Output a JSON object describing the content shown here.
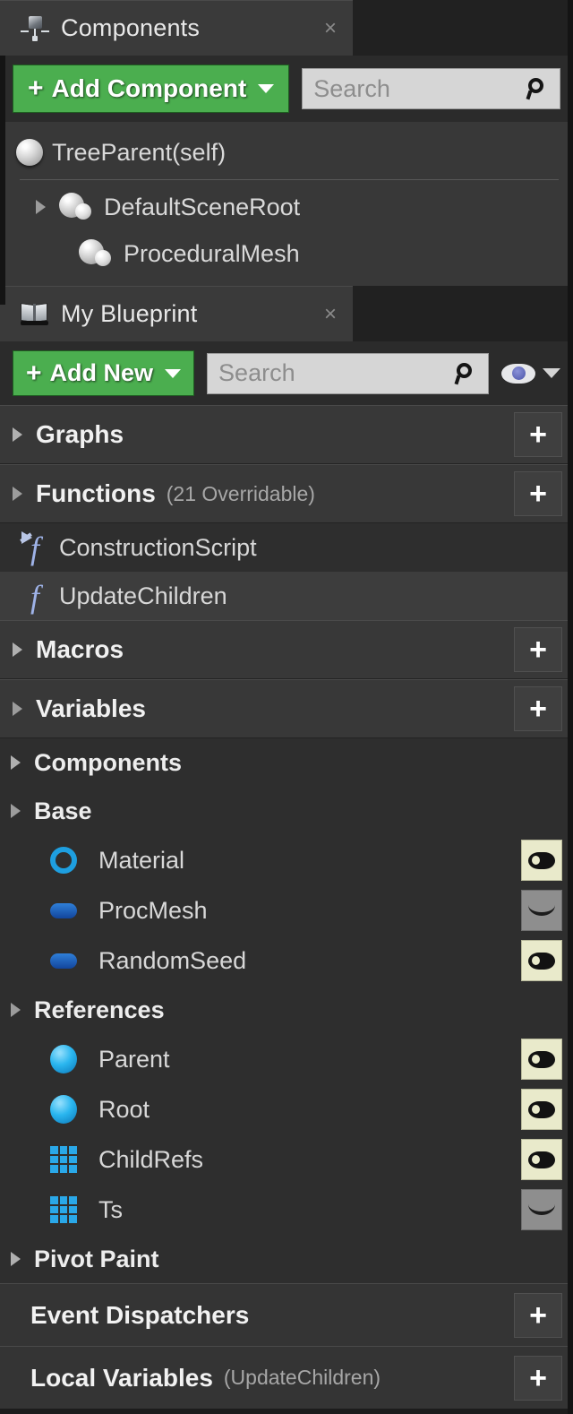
{
  "components_panel": {
    "tab": {
      "title": "Components",
      "icon": "components-cube-icon",
      "close": "×"
    },
    "toolbar": {
      "add_label": "Add Component",
      "plus": "+",
      "search_placeholder": "Search"
    },
    "tree": [
      {
        "label": "TreeParent(self)",
        "icon": "sphere-icon",
        "indent": 0,
        "arrow": "none"
      },
      {
        "label": "DefaultSceneRoot",
        "icon": "scene-component-icon",
        "indent": 1,
        "arrow": "expanded"
      },
      {
        "label": "ProceduralMesh",
        "icon": "scene-component-icon",
        "indent": 2,
        "arrow": "none"
      }
    ]
  },
  "my_blueprint_panel": {
    "tab": {
      "title": "My Blueprint",
      "icon": "book-icon",
      "close": "×"
    },
    "toolbar": {
      "add_label": "Add New",
      "plus": "+",
      "search_placeholder": "Search",
      "eye_icon": "eye-visibility-icon"
    },
    "sections": {
      "graphs": {
        "label": "Graphs",
        "expanded": false,
        "add": "+"
      },
      "functions": {
        "label": "Functions",
        "sub": "(21 Overridable)",
        "expanded": true,
        "add": "+",
        "items": [
          {
            "label": "ConstructionScript",
            "icon": "construction-script-icon",
            "selected": false
          },
          {
            "label": "UpdateChildren",
            "icon": "function-icon",
            "selected": true
          }
        ]
      },
      "macros": {
        "label": "Macros",
        "expanded": false,
        "add": "+"
      },
      "variables": {
        "label": "Variables",
        "expanded": true,
        "add": "+",
        "categories": [
          {
            "label": "Components",
            "expanded": false,
            "vars": []
          },
          {
            "label": "Base",
            "expanded": true,
            "vars": [
              {
                "label": "Material",
                "type_icon": "object-ring-icon",
                "eye": "visible"
              },
              {
                "label": "ProcMesh",
                "type_icon": "pill-icon",
                "eye": "hidden"
              },
              {
                "label": "RandomSeed",
                "type_icon": "pill-icon",
                "eye": "visible"
              }
            ]
          },
          {
            "label": "References",
            "expanded": true,
            "vars": [
              {
                "label": "Parent",
                "type_icon": "object-ball-icon",
                "eye": "visible"
              },
              {
                "label": "Root",
                "type_icon": "object-ball-icon",
                "eye": "visible"
              },
              {
                "label": "ChildRefs",
                "type_icon": "array-grid-icon",
                "eye": "visible"
              },
              {
                "label": "Ts",
                "type_icon": "array-grid-icon",
                "eye": "hidden"
              }
            ]
          },
          {
            "label": "Pivot Paint",
            "expanded": false,
            "vars": []
          }
        ]
      },
      "event_dispatchers": {
        "label": "Event Dispatchers",
        "add": "+"
      },
      "local_variables": {
        "label": "Local Variables",
        "sub": "(UpdateChildren)",
        "add": "+"
      }
    }
  },
  "colors": {
    "accent_green": "#4bae4f",
    "panel_bg": "#2e2e2e",
    "header_bg": "#383838",
    "object_blue": "#1e9fe0",
    "array_blue": "#2aa8e8"
  }
}
